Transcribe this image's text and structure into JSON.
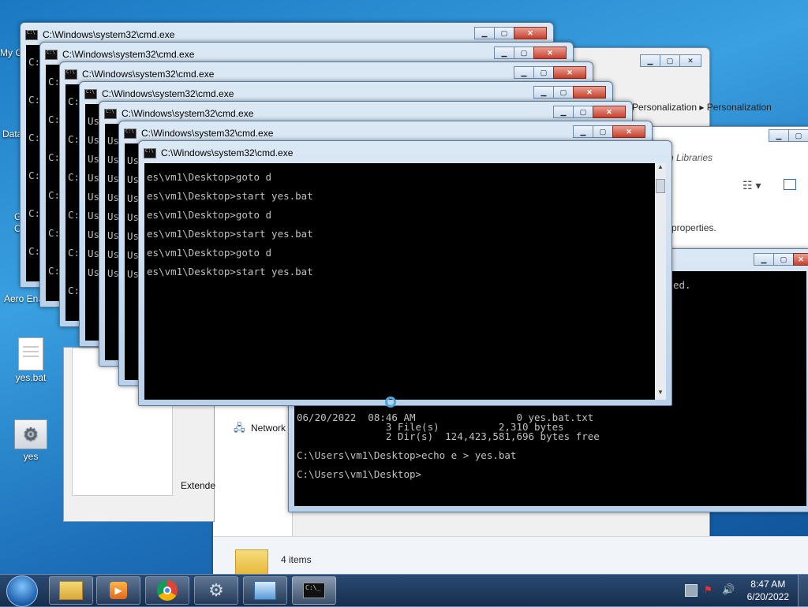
{
  "desktop": {
    "icons": [
      {
        "label": "yes.bat",
        "icon": "batch-file-icon"
      },
      {
        "label": "yes",
        "icon": "gear-settings-icon"
      }
    ],
    "edge_labels": [
      "My C",
      "Data",
      "G",
      "C",
      "Aero Ena"
    ]
  },
  "explorer": {
    "breadcrumb": "Personalization  ▸  Personalization",
    "search_placeholder": "ch Libraries",
    "properties_text": "properties.",
    "nav_network": "Network",
    "tab_extended": "Extende",
    "items_count": "4 items"
  },
  "cmd": {
    "title": "C:\\Windows\\system32\\cmd.exe",
    "prefix_us": "Us",
    "prefix_c": "C:",
    "front_lines": [
      "es\\vm1\\Desktop>goto d",
      "es\\vm1\\Desktop>start yes.bat",
      "es\\vm1\\Desktop>goto d",
      "es\\vm1\\Desktop>start yes.bat",
      "es\\vm1\\Desktop>goto d",
      "es\\vm1\\Desktop>start yes.bat"
    ],
    "rear_partial": "ed.",
    "rear_lines": [
      "06/20/2022  08:46 AM                 0 yes.bat.txt",
      "               3 File(s)          2,310 bytes",
      "               2 Dir(s)  124,423,581,696 bytes free",
      "",
      "C:\\Users\\vm1\\Desktop>echo e > yes.bat",
      "",
      "C:\\Users\\vm1\\Desktop>"
    ]
  },
  "taskbar": {
    "apps": [
      "explorer-icon",
      "media-player-icon",
      "chrome-icon",
      "settings-icon",
      "control-panel-icon",
      "cmd-icon"
    ],
    "time": "8:47 AM",
    "date": "6/20/2022"
  }
}
